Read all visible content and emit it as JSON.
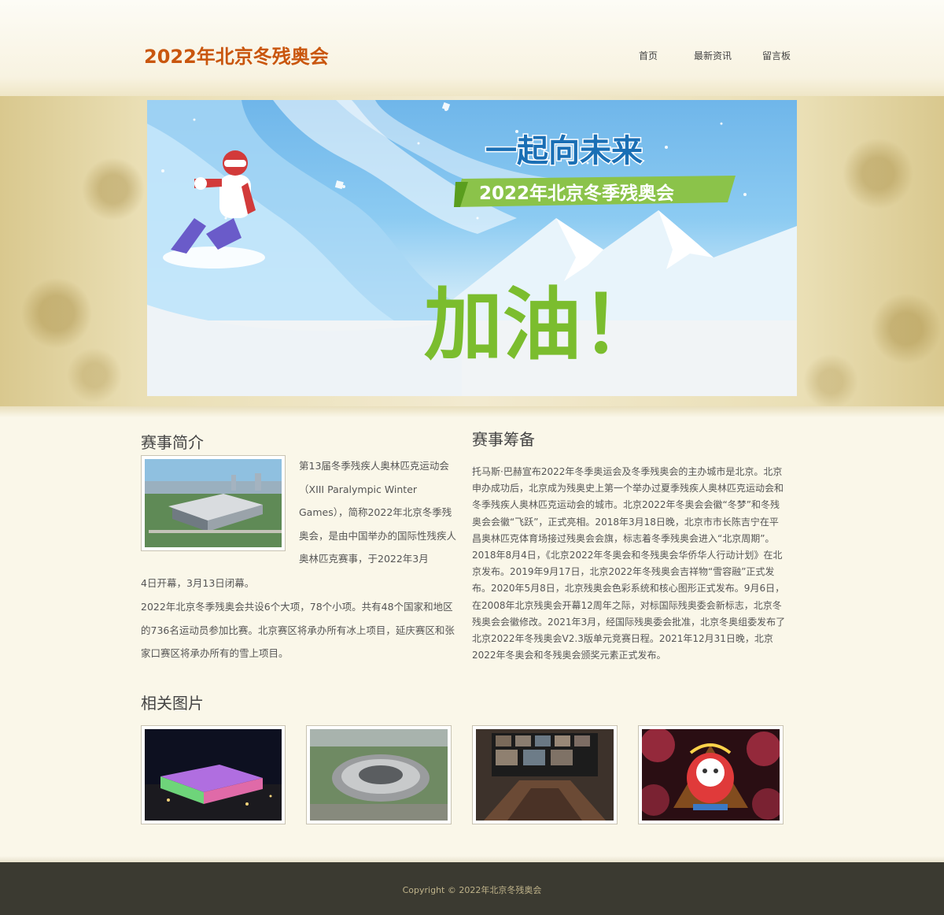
{
  "header": {
    "logo": "2022年北京冬残奥会",
    "nav": [
      {
        "label": "首页"
      },
      {
        "label": "最新资讯"
      },
      {
        "label": "留言板"
      }
    ]
  },
  "banner": {
    "slogan": "一起向未来",
    "ribbon": "2022年北京冬季残奥会",
    "cheer": "加油！"
  },
  "intro": {
    "title": "赛事简介",
    "para1": "第13届冬季残疾人奥林匹克运动会（XIII Paralympic Winter Games），简称2022年北京冬季残奥会，是由中国举办的国际性残疾人奥林匹克赛事，于2022年3月4日开幕，3月13日闭幕。",
    "para2": "2022年北京冬季残奥会共设6个大项，78个小项。共有48个国家和地区的736名运动员参加比赛。北京赛区将承办所有冰上项目，延庆赛区和张家口赛区将承办所有的雪上项目。"
  },
  "prep": {
    "title": "赛事筹备",
    "text": "托马斯·巴赫宣布2022年冬季奥运会及冬季残奥会的主办城市是北京。北京申办成功后，北京成为残奥史上第一个举办过夏季残疾人奥林匹克运动会和冬季残疾人奥林匹克运动会的城市。北京2022年冬奥会会徽“冬梦”和冬残奥会会徽“飞跃”，正式亮相。2018年3月18日晚，北京市市长陈吉宁在平昌奥林匹克体育场接过残奥会会旗，标志着冬季残奥会进入“北京周期”。2018年8月4日，《北京2022年冬奥会和冬残奥会华侨华人行动计划》在北京发布。2019年9月17日，北京2022年冬残奥会吉祥物“雪容融”正式发布。2020年5月8日，北京残奥会色彩系统和核心图形正式发布。9月6日，在2008年北京残奥会开幕12周年之际，对标国际残奥委会新标志，北京冬残奥会会徽修改。2021年3月，经国际残奥委会批准，北京冬奥组委发布了北京2022年冬残奥会V2.3版单元竞赛日程。2021年12月31日晚，北京2022年冬奥会和冬残奥会颁奖元素正式发布。"
  },
  "gallery": {
    "title": "相关图片"
  },
  "footer": {
    "copyright": "Copyright © 2022年北京冬残奥会"
  },
  "colors": {
    "accent": "#c9560e",
    "footer_bg": "#3b3a31",
    "banner_green": "#7bbd2e"
  }
}
